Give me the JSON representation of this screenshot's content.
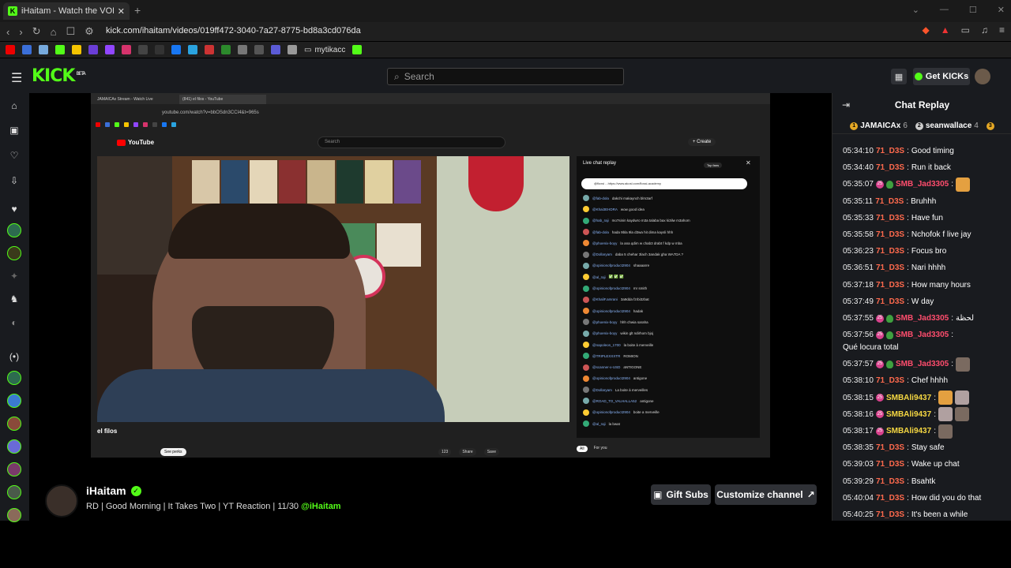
{
  "browser": {
    "tab_title": "iHaitam - Watch the VOD on",
    "url": "kick.com/ihaitam/videos/019ff472-3040-7a27-8775-bd8a3cd076da",
    "bookmark_folder": "mytikacc"
  },
  "header": {
    "logo": "KICK",
    "logo_sup": "BETA",
    "search_placeholder": "Search",
    "get_kicks_label": "Get KICKs"
  },
  "video": {
    "inner_tab_1": "JAMAICAx Stream - Watch Live",
    "inner_tab_2": "(841) el filos - YouTube",
    "inner_url": "youtube.com/watch?v=bbOSdn3CCI4&t=965s",
    "yt_logo": "YouTube",
    "yt_search": "Search",
    "yt_create": "+ Create",
    "live_chat_title": "Live chat replay",
    "live_chat_top": "Top fans",
    "pinned": "@floxsi ...https://www.akosl.com/flossi-academy",
    "video_title": "el filos",
    "perks": "See perks",
    "likes": "123",
    "share": "Share",
    "save": "Save",
    "filter_all": "All",
    "filter_you": "For you",
    "chat_rows": [
      {
        "u": "@fab-dola",
        "m": "dakchi makaynch blm3arf"
      },
      {
        "u": "@Khai3EHDRA",
        "m": "wow good idea"
      },
      {
        "u": "@hab_raji",
        "m": "mo7sinin kaydwro m3a talaba bax ki3ilw m3ahom"
      },
      {
        "u": "@fab-dola",
        "m": "hada 9bla 9la d3wa hit dima kaysli hhh"
      },
      {
        "u": "@phoenix-boyy",
        "m": "la ana qdim w chab3 drabt f kdp w mba"
      },
      {
        "u": "@Dollaryam",
        "m": "daba 5 chehar 3lach 3andak gha WA7DA ?"
      },
      {
        "u": "@opinionofproduct2904",
        "m": "shaaaarre"
      },
      {
        "u": "@al_raji",
        "m": "✅ ✅ ✅"
      },
      {
        "u": "@opinionofproduct2904",
        "m": "mr smith"
      },
      {
        "u": "@KhaliF.amrani",
        "m": "3a9dda fzrbi3zbat"
      },
      {
        "u": "@opinionofproduct2904",
        "m": "hadak"
      },
      {
        "u": "@phoenix-boyy",
        "m": "hhh chwia saraha"
      },
      {
        "u": "@phoenix-boyy",
        "m": "wikin glt ndirhom bjoj"
      },
      {
        "u": "@napoleon_1700",
        "m": "la boite à merveille"
      },
      {
        "u": "@TRIPLEXXXTR",
        "m": "ROMION"
      },
      {
        "u": "@scanner-x-USD",
        "m": "aNTIGONE"
      },
      {
        "u": "@opinionofproduct2904",
        "m": "antigone"
      },
      {
        "u": "@Dollaryam",
        "m": "La boite à merveilles"
      },
      {
        "u": "@ROAD_TO_VALHALLA52",
        "m": "antigone"
      },
      {
        "u": "@opinionofproduct2904",
        "m": "boite a merveille"
      },
      {
        "u": "@al_raji",
        "m": "la bwat"
      }
    ]
  },
  "channel": {
    "name": "iHaitam",
    "stream_title": "RD | Good Morning | It Takes Two | YT Reaction | 11/30",
    "mention": "@iHaitam",
    "gift_subs_label": "Gift Subs",
    "customize_label": "Customize channel"
  },
  "chat": {
    "title": "Chat Replay",
    "gifters": [
      {
        "name": "JAMAICAx",
        "count": "6"
      },
      {
        "name": "seanwallace",
        "count": "4"
      }
    ],
    "messages": [
      {
        "ts": "05:34:10",
        "user": "71_D3S",
        "color": "#ff6a4d",
        "text": "Good timing",
        "badges": 0,
        "emotes": 0
      },
      {
        "ts": "05:34:40",
        "user": "71_D3S",
        "color": "#ff6a4d",
        "text": "Run it back",
        "badges": 0,
        "emotes": 0
      },
      {
        "ts": "05:35:07",
        "user": "SMB_Jad3305",
        "color": "#ff4d6d",
        "text": "",
        "badges": 2,
        "emotes": 1
      },
      {
        "ts": "05:35:11",
        "user": "71_D3S",
        "color": "#ff6a4d",
        "text": "Bruhhh",
        "badges": 0,
        "emotes": 0
      },
      {
        "ts": "05:35:33",
        "user": "71_D3S",
        "color": "#ff6a4d",
        "text": "Have fun",
        "badges": 0,
        "emotes": 0
      },
      {
        "ts": "05:35:58",
        "user": "71_D3S",
        "color": "#ff6a4d",
        "text": "Nchofok f live jay",
        "badges": 0,
        "emotes": 0
      },
      {
        "ts": "05:36:23",
        "user": "71_D3S",
        "color": "#ff6a4d",
        "text": "Focus bro",
        "badges": 0,
        "emotes": 0
      },
      {
        "ts": "05:36:51",
        "user": "71_D3S",
        "color": "#ff6a4d",
        "text": "Nari hhhh",
        "badges": 0,
        "emotes": 0
      },
      {
        "ts": "05:37:18",
        "user": "71_D3S",
        "color": "#ff6a4d",
        "text": "How many hours",
        "badges": 0,
        "emotes": 0
      },
      {
        "ts": "05:37:49",
        "user": "71_D3S",
        "color": "#ff6a4d",
        "text": "W day",
        "badges": 0,
        "emotes": 0
      },
      {
        "ts": "05:37:55",
        "user": "SMB_Jad3305",
        "color": "#ff4d6d",
        "text": "لحظة",
        "badges": 2,
        "emotes": 0
      },
      {
        "ts": "05:37:56",
        "user": "SMB_Jad3305",
        "color": "#ff4d6d",
        "text": "Qué locura total",
        "badges": 2,
        "emotes": 0,
        "wrap": true
      },
      {
        "ts": "05:37:57",
        "user": "SMB_Jad3305",
        "color": "#ff4d6d",
        "text": "",
        "badges": 2,
        "emotes": 1
      },
      {
        "ts": "05:38:10",
        "user": "71_D3S",
        "color": "#ff6a4d",
        "text": "Chef hhhh",
        "badges": 0,
        "emotes": 0
      },
      {
        "ts": "05:38:15",
        "user": "SMBAli9437",
        "color": "#f5d742",
        "text": "",
        "badges": 1,
        "emotes": 2
      },
      {
        "ts": "05:38:16",
        "user": "SMBAli9437",
        "color": "#f5d742",
        "text": "",
        "badges": 1,
        "emotes": 2
      },
      {
        "ts": "05:38:17",
        "user": "SMBAli9437",
        "color": "#f5d742",
        "text": "",
        "badges": 1,
        "emotes": 1
      },
      {
        "ts": "05:38:35",
        "user": "71_D3S",
        "color": "#ff6a4d",
        "text": "Stay safe",
        "badges": 0,
        "emotes": 0
      },
      {
        "ts": "05:39:03",
        "user": "71_D3S",
        "color": "#ff6a4d",
        "text": "Wake up chat",
        "badges": 0,
        "emotes": 0
      },
      {
        "ts": "05:39:29",
        "user": "71_D3S",
        "color": "#ff6a4d",
        "text": "Bsahtk",
        "badges": 0,
        "emotes": 0
      },
      {
        "ts": "05:40:04",
        "user": "71_D3S",
        "color": "#ff6a4d",
        "text": "How did you do that",
        "badges": 0,
        "emotes": 0
      },
      {
        "ts": "05:40:25",
        "user": "71_D3S",
        "color": "#ff6a4d",
        "text": "It's been a while",
        "badges": 0,
        "emotes": 0
      }
    ]
  },
  "colors": {
    "accent": "#53fc18",
    "header_bg": "#191b1f",
    "page_bg": "#000000"
  }
}
